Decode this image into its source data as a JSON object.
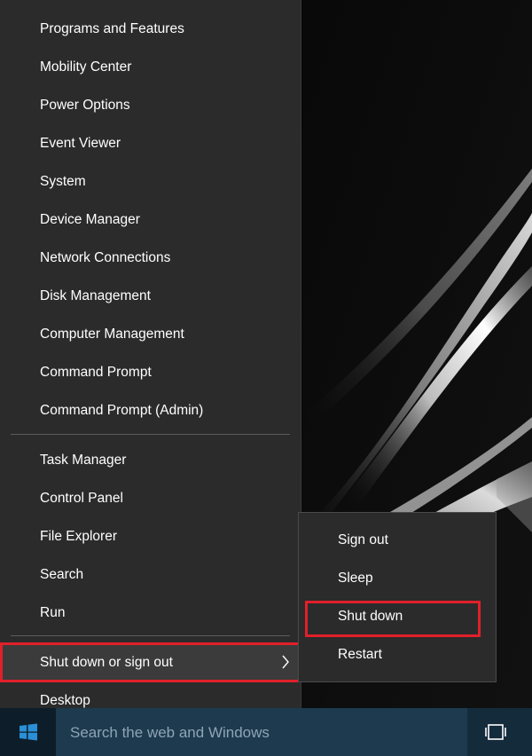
{
  "menu": {
    "group1": [
      "Programs and Features",
      "Mobility Center",
      "Power Options",
      "Event Viewer",
      "System",
      "Device Manager",
      "Network Connections",
      "Disk Management",
      "Computer Management",
      "Command Prompt",
      "Command Prompt (Admin)"
    ],
    "group2": [
      "Task Manager",
      "Control Panel",
      "File Explorer",
      "Search",
      "Run"
    ],
    "shutdown": "Shut down or sign out",
    "desktop": "Desktop"
  },
  "submenu": {
    "items": [
      "Sign out",
      "Sleep",
      "Shut down",
      "Restart"
    ],
    "highlighted": "Shut down"
  },
  "taskbar": {
    "search_placeholder": "Search the web and Windows"
  },
  "colors": {
    "highlight_border": "#e0202a",
    "menu_background": "#2b2b2b",
    "taskbar": "#142b3c"
  },
  "icons": [
    "windows-logo-icon",
    "chevron-right-icon",
    "task-view-icon"
  ]
}
